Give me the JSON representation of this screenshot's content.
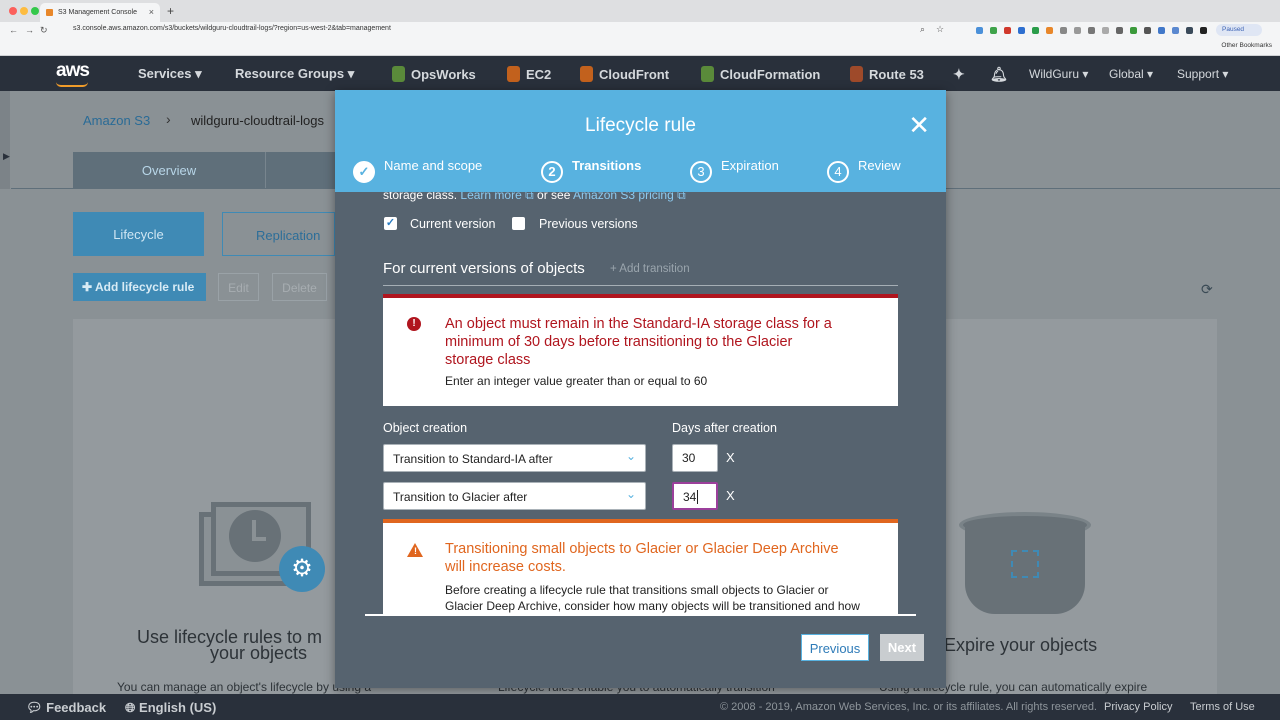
{
  "browser": {
    "tab_title": "S3 Management Console",
    "tab_close": "×",
    "new_tab": "+",
    "url": "s3.console.aws.amazon.com/s3/buckets/wildguru-cloudtrail-logs/?region=us-west-2&tab=management",
    "paused": "Paused",
    "other_bookmarks": "Other Bookmarks"
  },
  "nav": {
    "logo": "aws",
    "services": "Services",
    "resource_groups": "Resource Groups",
    "opsworks": "OpsWorks",
    "ec2": "EC2",
    "cloudfront": "CloudFront",
    "cloudformation": "CloudFormation",
    "route53": "Route 53",
    "account": "WildGuru",
    "region": "Global",
    "support": "Support",
    "caret": "▾"
  },
  "background": {
    "breadcrumb_root": "Amazon S3",
    "breadcrumb_sep": "›",
    "breadcrumb_bucket": "wildguru-cloudtrail-logs",
    "tab_overview": "Overview",
    "subtab_lifecycle": "Lifecycle",
    "subtab_replication": "Replication",
    "add_rule": "Add lifecycle rule",
    "edit": "Edit",
    "delete": "Delete",
    "card1_title_line1": "Use lifecycle rules to m",
    "card1_title_line2": "your objects",
    "card1_text": "You can manage an object's lifecycle by using a",
    "card2_text": "Lifecycle rules enable you to automatically transition",
    "card3_title": "Expire your objects",
    "card3_text": "Using a lifecycle rule, you can automatically expire"
  },
  "modal": {
    "title": "Lifecycle rule",
    "close": "✕",
    "steps": [
      {
        "num": "✓",
        "label": "Name and scope"
      },
      {
        "num": "2",
        "label": "Transitions"
      },
      {
        "num": "3",
        "label": "Expiration"
      },
      {
        "num": "4",
        "label": "Review"
      }
    ],
    "intro_prefix": "storage class.",
    "learn_more": "Learn more",
    "or_see": "or see",
    "pricing_link": "Amazon S3 pricing",
    "current_version": "Current version",
    "previous_versions": "Previous versions",
    "section_title": "For current versions of objects",
    "add_transition": "+ Add transition",
    "error": {
      "line1": "An object must remain in the Standard-IA storage class for a",
      "line2": "minimum of 30 days before transitioning to the Glacier",
      "line3": "storage class",
      "hint": "Enter an integer value greater than or equal to 60"
    },
    "col_creation": "Object creation",
    "col_days": "Days after creation",
    "rows": [
      {
        "select": "Transition to Standard-IA after",
        "days": "30",
        "remove": "X"
      },
      {
        "select": "Transition to Glacier after",
        "days": "34",
        "remove": "X"
      }
    ],
    "warning": {
      "line1": "Transitioning small objects to Glacier or Glacier Deep Archive",
      "line2": "will increase costs.",
      "body1": "Before creating a lifecycle rule that transitions small objects to Glacier or",
      "body2": "Glacier Deep Archive, consider how many objects will be transitioned and how"
    },
    "previous": "Previous",
    "next": "Next"
  },
  "footer": {
    "feedback": "Feedback",
    "language": "English (US)",
    "copyright": "© 2008 - 2019, Amazon Web Services, Inc. or its affiliates. All rights reserved.",
    "privacy": "Privacy Policy",
    "terms": "Terms of Use"
  },
  "colors": {
    "accent": "#58b2e0",
    "error": "#b0151e",
    "warning": "#e0661f",
    "nav_bg": "#29303b"
  }
}
